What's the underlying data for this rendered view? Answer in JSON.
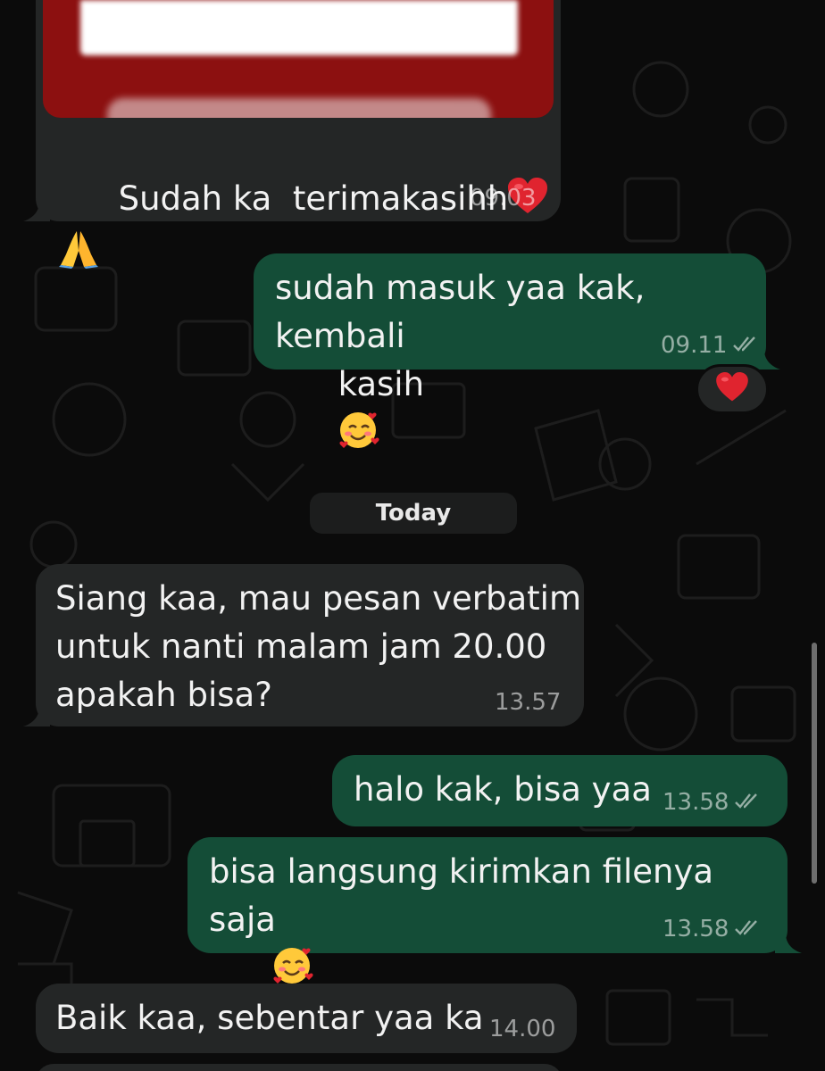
{
  "chat": {
    "date_separator": "Today",
    "messages": [
      {
        "direction": "incoming",
        "text": "Sudah ka  terimakasihh",
        "time": "09.03",
        "attachment": "image"
      },
      {
        "direction": "outgoing",
        "text_line1": "sudah masuk yaa kak, kembali",
        "text_line2": "kasih",
        "time": "09.11",
        "status": "read",
        "reaction": "heart"
      },
      {
        "direction": "incoming",
        "text_line1": "Siang kaa, mau pesan verbatim",
        "text_line2": "untuk nanti malam jam 20.00",
        "text_line3": "apakah bisa?",
        "time": "13.57"
      },
      {
        "direction": "outgoing",
        "text": "halo kak, bisa yaa",
        "time": "13.58",
        "status": "read"
      },
      {
        "direction": "outgoing",
        "text": "bisa langsung kirimkan filenya saja",
        "time": "13.58",
        "status": "read"
      },
      {
        "direction": "incoming",
        "text": "Baik kaa, sebentar yaa ka",
        "time": "14.00"
      }
    ]
  },
  "colors": {
    "background": "#0b0b0b",
    "incoming_bubble": "#242626",
    "outgoing_bubble": "#144d37",
    "attachment_frame": "#8c1010"
  },
  "icons": [
    "red-heart-emoji",
    "folded-hands-emoji",
    "smiling-face-with-hearts-emoji",
    "double-check-icon"
  ]
}
